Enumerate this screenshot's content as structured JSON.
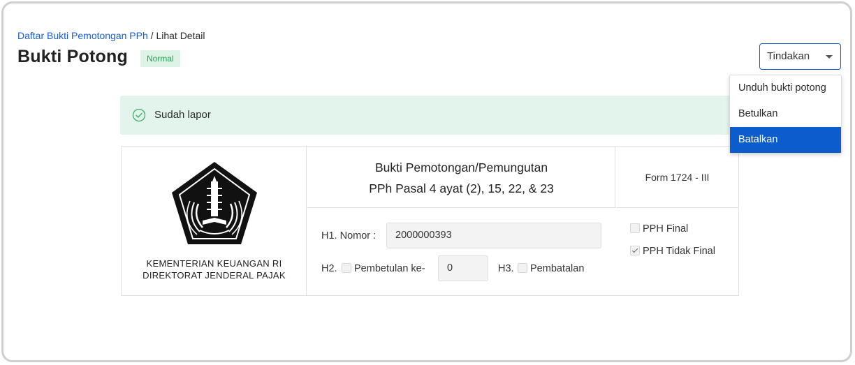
{
  "breadcrumb": {
    "parent": "Daftar Bukti Pemotongan PPh",
    "separator": " / ",
    "current": "Lihat Detail"
  },
  "header": {
    "title": "Bukti Potong",
    "status_badge": "Normal"
  },
  "actions": {
    "selected": "Tindakan",
    "menu": [
      {
        "label": "Unduh bukti potong",
        "highlighted": false
      },
      {
        "label": "Betulkan",
        "highlighted": false
      },
      {
        "label": "Batalkan",
        "highlighted": true
      }
    ]
  },
  "alert": {
    "icon": "check-circle-icon",
    "text": "Sudah lapor"
  },
  "document": {
    "org_line1": "KEMENTERIAN KEUANGAN RI",
    "org_line2": "DIREKTORAT JENDERAL PAJAK",
    "title_line1": "Bukti Pemotongan/Pemungutan",
    "title_line2": "PPh Pasal 4 ayat (2), 15, 22, & 23",
    "form_code": "Form 1724 - III",
    "h1_label": "H1. Nomor :",
    "h1_value": "2000000393",
    "h2_prefix": "H2.",
    "h2_label": "Pembetulan ke-",
    "h2_value": "0",
    "h2_checked": false,
    "h3_prefix": "H3.",
    "h3_label": "Pembatalan",
    "h3_checked": false,
    "pph_final_label": "PPH Final",
    "pph_final_checked": false,
    "pph_tidak_final_label": "PPH Tidak Final",
    "pph_tidak_final_checked": true
  },
  "colors": {
    "link": "#1a5bd6",
    "badge_bg": "#ddf3e5",
    "badge_text": "#2a9a55",
    "alert_bg": "#e2f4ec",
    "menu_active": "#0b5ccd"
  }
}
